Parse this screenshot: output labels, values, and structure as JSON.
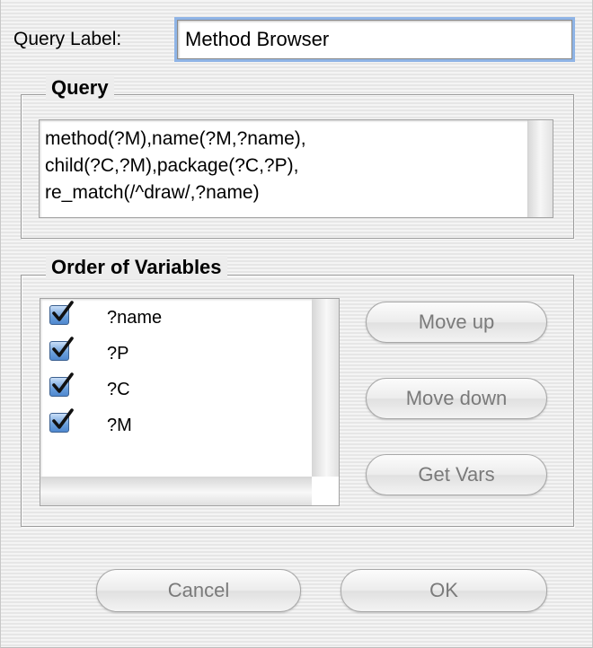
{
  "query_label": {
    "label": "Query Label:",
    "value": "Method Browser"
  },
  "query": {
    "title": "Query",
    "text": "method(?M),name(?M,?name),\nchild(?C,?M),package(?C,?P),\nre_match(/^draw/,?name)"
  },
  "variables": {
    "title": "Order of Variables",
    "items": [
      {
        "label": "?name",
        "checked": true
      },
      {
        "label": "?P",
        "checked": true
      },
      {
        "label": "?C",
        "checked": true
      },
      {
        "label": "?M",
        "checked": true
      }
    ]
  },
  "buttons": {
    "move_up": "Move up",
    "move_down": "Move down",
    "get_vars": "Get Vars",
    "cancel": "Cancel",
    "ok": "OK"
  },
  "colors": {
    "focus_ring": "#8fb4e6",
    "checkbox_fill": "#6a9fdc",
    "disabled_text": "#7a7a7a"
  }
}
